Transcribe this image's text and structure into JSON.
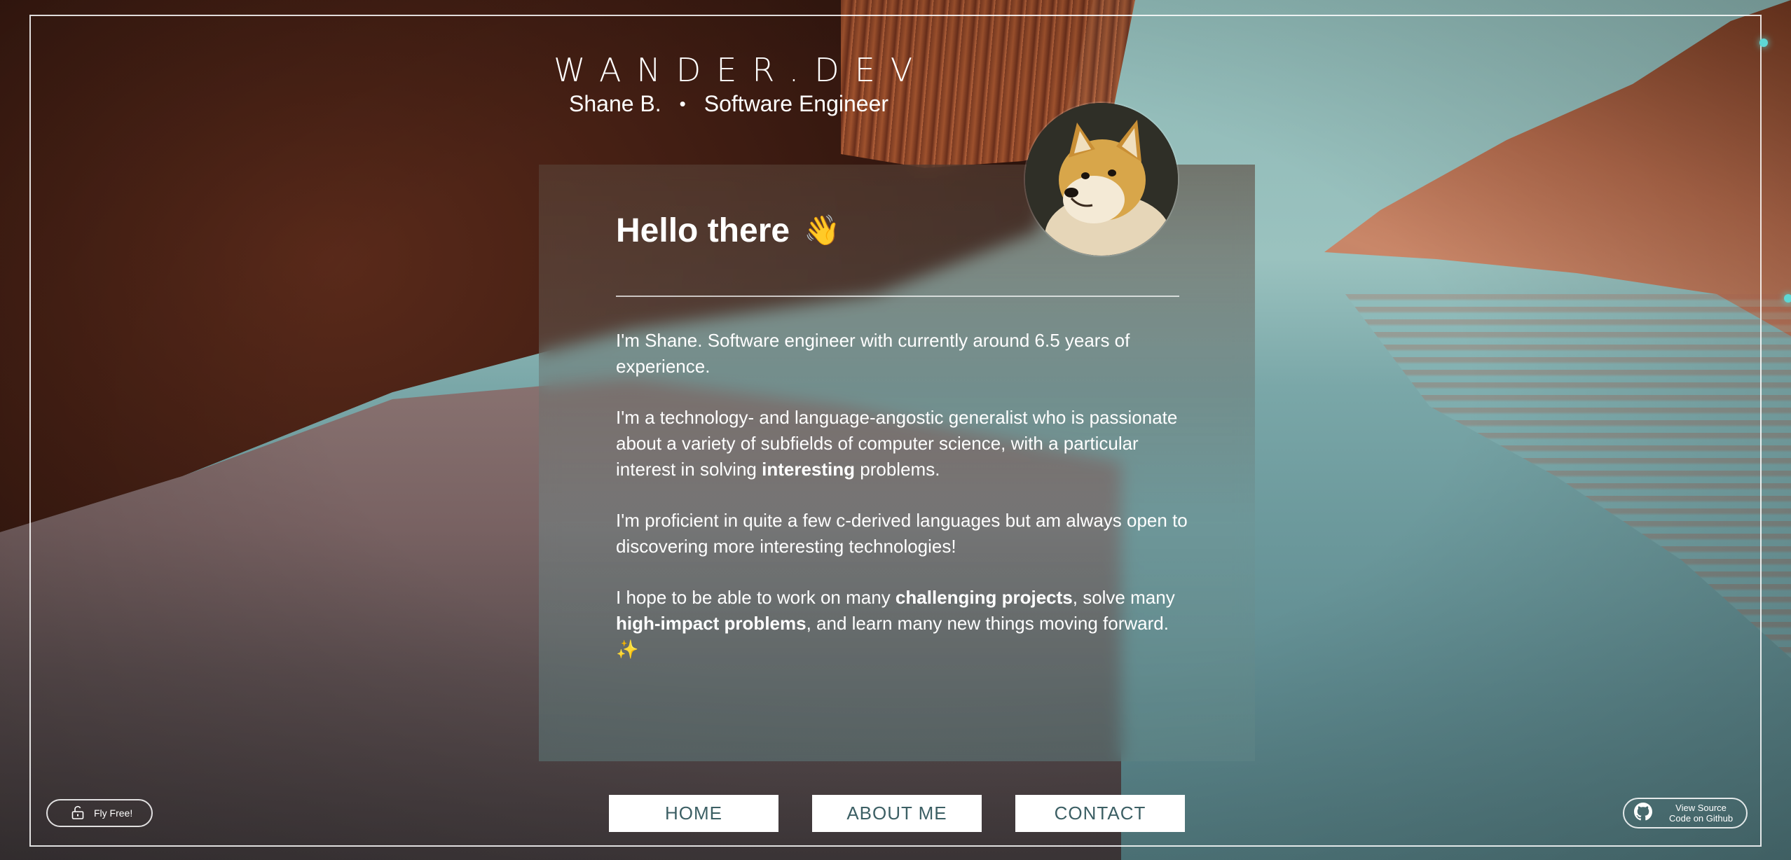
{
  "header": {
    "brand": "WANDER.DEV",
    "name": "Shane B.",
    "separator": "•",
    "role": "Software Engineer"
  },
  "card": {
    "title": "Hello there",
    "wave_emoji": "👋",
    "paragraphs": {
      "p1": "I'm Shane. Software engineer with currently around 6.5 years of experience.",
      "p2_a": "I'm a technology- and language-angostic generalist who is passionate about a variety of subfields of computer science, with a particular interest in solving ",
      "p2_b": "interesting",
      "p2_c": " problems.",
      "p3": "I'm proficient in quite a few c-derived languages but am always open to discovering more interesting technologies!",
      "p4_a": "I hope to be able to work on many ",
      "p4_b": "challenging projects",
      "p4_c": ", solve many ",
      "p4_d": "high-impact problems",
      "p4_e": ", and learn many new things moving forward. ",
      "p4_emoji": "✨"
    }
  },
  "nav": {
    "home": "HOME",
    "about": "ABOUT ME",
    "contact": "CONTACT"
  },
  "fly": {
    "label": "Fly Free!",
    "icon": "unlock-icon"
  },
  "github": {
    "line1": "View Source",
    "line2": "Code on Github",
    "icon": "github-icon"
  },
  "colors": {
    "nav_text": "#3c5f64",
    "accent_dot": "#5ed7d4"
  }
}
